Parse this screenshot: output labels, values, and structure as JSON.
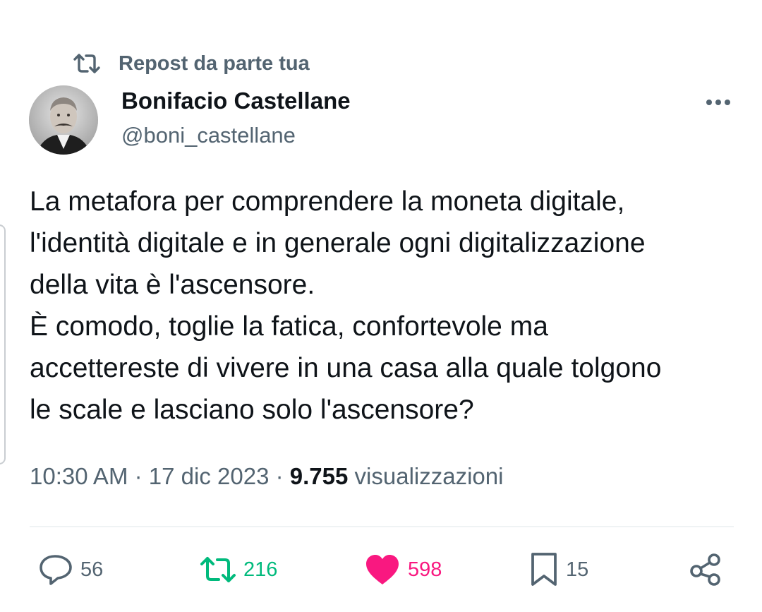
{
  "repost": {
    "label": "Repost da parte tua",
    "icon": "repost-icon"
  },
  "author": {
    "name": "Bonifacio Castellane",
    "handle": "@boni_castellane",
    "avatar_icon": "avatar-portrait"
  },
  "tweet": {
    "lines": [
      "La metafora per comprendere la moneta digitale,",
      "l'identità digitale e in generale ogni digitalizzazione",
      "della vita è l'ascensore.",
      "È comodo, toglie la fatica, confortevole ma",
      "accettereste di vivere in una casa alla quale tolgono",
      "le scale e lasciano solo l'ascensore?"
    ]
  },
  "meta": {
    "time": "10:30 AM",
    "separator": "·",
    "date": "17 dic 2023",
    "views_count": "9.755",
    "views_label": "visualizzazioni"
  },
  "actions": {
    "replies": "56",
    "reposts": "216",
    "likes": "598",
    "bookmarks": "15"
  },
  "colors": {
    "text_primary": "#0f1419",
    "text_secondary": "#536471",
    "repost_green": "#00ba7c",
    "like_pink": "#f91880",
    "divider": "#eff3f4"
  }
}
